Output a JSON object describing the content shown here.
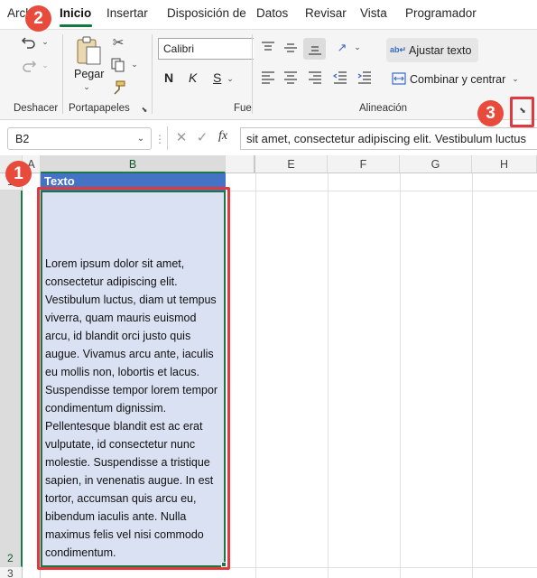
{
  "tabs": [
    {
      "label": "Arch",
      "active": false
    },
    {
      "label": "Inicio",
      "active": true
    },
    {
      "label": "Insertar",
      "active": false
    },
    {
      "label": "Disposición de",
      "active": false
    },
    {
      "label": "Datos",
      "active": false
    },
    {
      "label": "Revisar",
      "active": false
    },
    {
      "label": "Vista",
      "active": false
    },
    {
      "label": "Programador",
      "active": false
    }
  ],
  "ribbon": {
    "undo_group": "Deshacer",
    "clipboard_group": "Portapapeles",
    "paste_label": "Pegar",
    "font_group": "Fue",
    "font_name": "Calibri",
    "bold": "N",
    "italic": "K",
    "underline": "S",
    "alignment_group": "Alineación",
    "wrap_text": "Ajustar texto",
    "merge_center": "Combinar y centrar"
  },
  "formula_bar": {
    "name_box": "B2",
    "fx": "fx",
    "content": "sit amet, consectetur adipiscing elit. Vestibulum luctus"
  },
  "columns": [
    "A",
    "B",
    "E",
    "F",
    "G",
    "H"
  ],
  "rows": [
    "1",
    "2",
    "3"
  ],
  "cells": {
    "B1": "Texto",
    "B2": "Lorem ipsum dolor sit amet, consectetur adipiscing elit. Vestibulum luctus, diam ut tempus viverra, quam mauris euismod arcu, id blandit orci justo quis augue. Vivamus arcu ante, iaculis eu mollis non, lobortis et lacus. Suspendisse tempor lorem tempor condimentum dignissim. Pellentesque blandit est ac erat vulputate, id consectetur nunc molestie. Suspendisse a tristique sapien, in venenatis augue. In est tortor, accumsan quis arcu eu, bibendum iaculis ante. Nulla maximus felis vel nisi commodo condimentum."
  },
  "callouts": [
    "1",
    "2",
    "3"
  ],
  "colors": {
    "accent": "#117a3e",
    "header_fill": "#4472c4",
    "cell_fill": "#d9e1f2",
    "callout": "#e84b3c"
  }
}
